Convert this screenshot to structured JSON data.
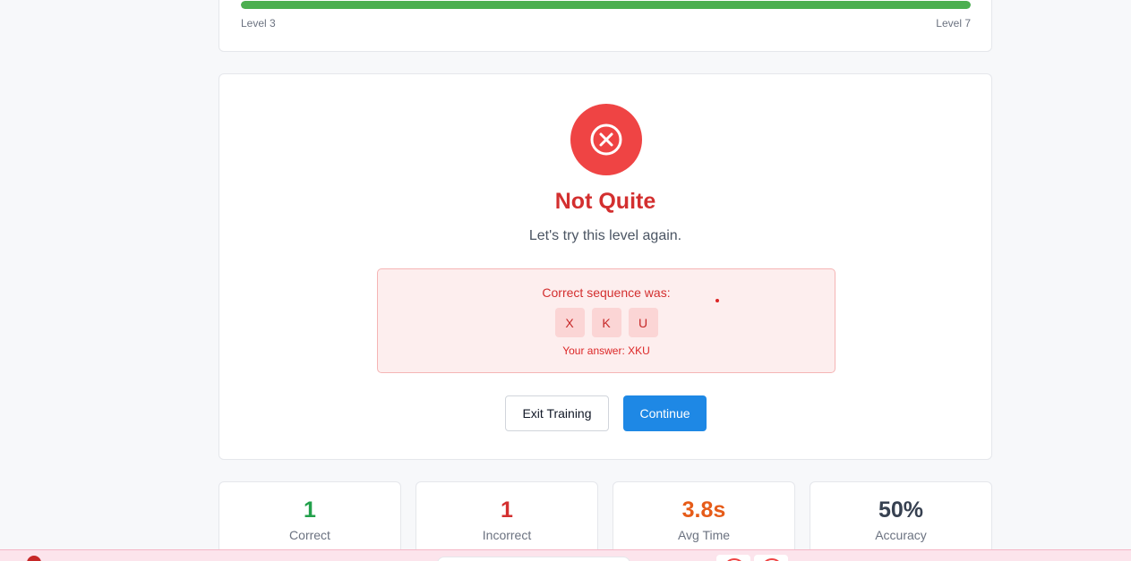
{
  "progress": {
    "fill_fraction": 1.0,
    "start_label": "Level 3",
    "end_label": "Level 7",
    "fill_color": "#4caf50"
  },
  "result": {
    "icon": "x-circle-icon",
    "title": "Not Quite",
    "subtitle": "Let's try this level again.",
    "sequence_label": "Correct sequence was:",
    "sequence": [
      "X",
      "K",
      "U"
    ],
    "your_answer": "Your answer: XKU",
    "accent_color": "#ef4444"
  },
  "actions": {
    "exit_label": "Exit Training",
    "continue_label": "Continue"
  },
  "stats": [
    {
      "value": "1",
      "label": "Correct",
      "color": "#22a04b"
    },
    {
      "value": "1",
      "label": "Incorrect",
      "color": "#d32f2f"
    },
    {
      "value": "3.8s",
      "label": "Avg Time",
      "color": "#e65c19"
    },
    {
      "value": "50%",
      "label": "Accuracy",
      "color": "#374151"
    }
  ]
}
